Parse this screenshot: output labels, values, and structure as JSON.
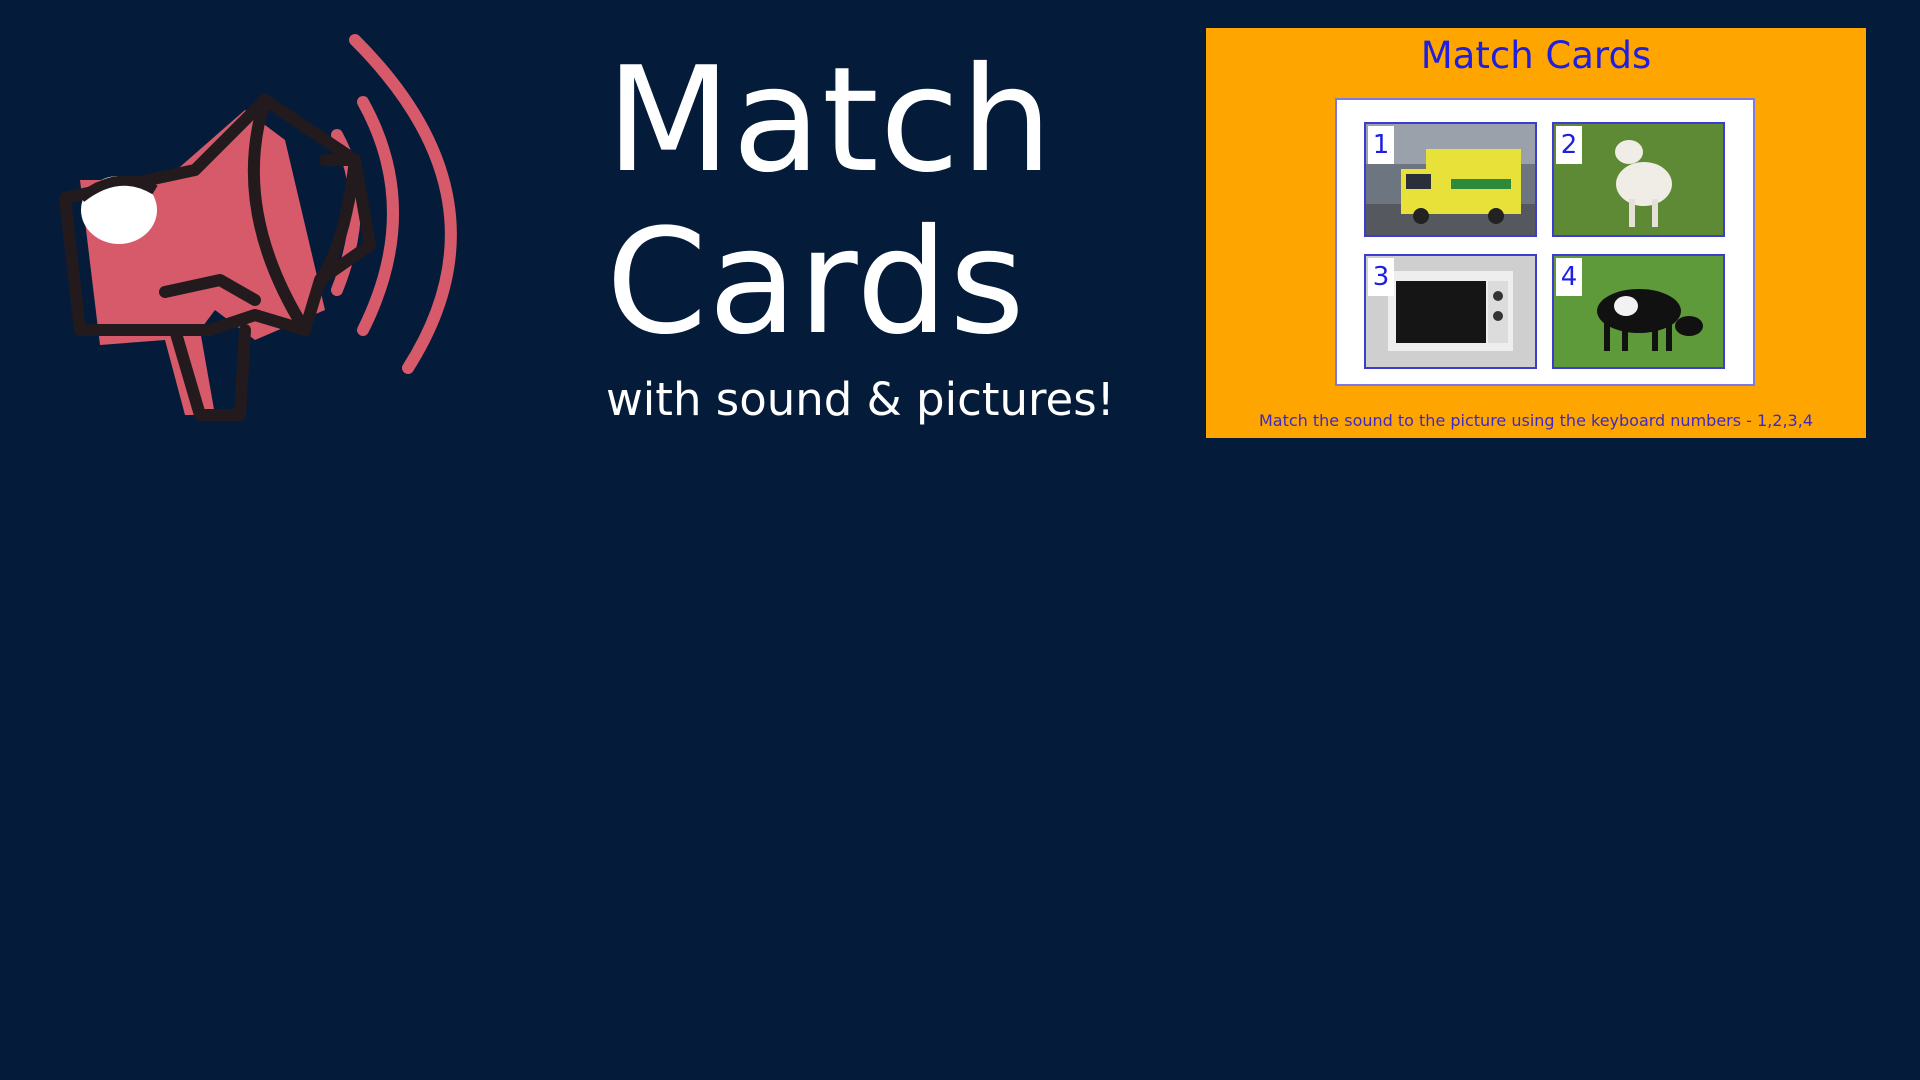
{
  "title": {
    "line1": "Match",
    "line2": "Cards",
    "subtitle": "with sound & pictures!"
  },
  "preview": {
    "title": "Match Cards",
    "instructions": "Match the sound to the picture using the keyboard numbers - 1,2,3,4",
    "cards": [
      {
        "number": "1",
        "subject": "ambulance"
      },
      {
        "number": "2",
        "subject": "lamb"
      },
      {
        "number": "3",
        "subject": "microwave"
      },
      {
        "number": "4",
        "subject": "cow"
      }
    ]
  },
  "colors": {
    "background": "#041c3a",
    "megaphone": "#d65a6a",
    "outline": "#231a1e",
    "preview_bg": "#ffa500",
    "preview_text": "#1f1fe0"
  },
  "icons": [
    "megaphone-icon"
  ]
}
